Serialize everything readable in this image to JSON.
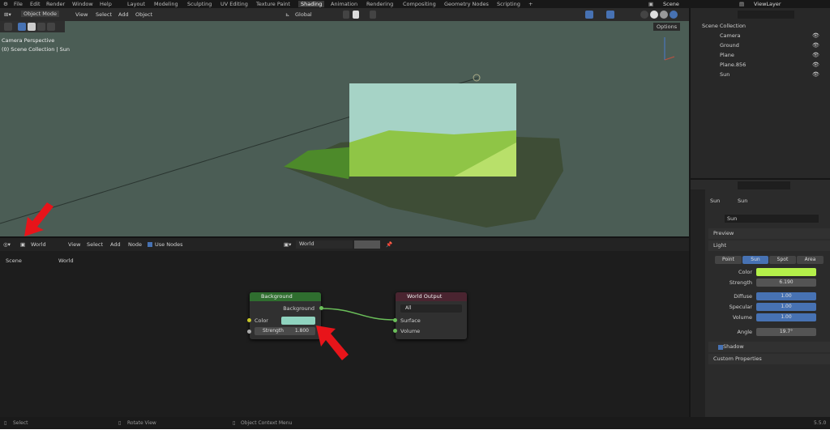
{
  "menu": [
    "File",
    "Edit",
    "Render",
    "Window",
    "Help"
  ],
  "workspaces": [
    "Layout",
    "Modeling",
    "Sculpting",
    "UV Editing",
    "Texture Paint",
    "Shading",
    "Animation",
    "Rendering",
    "Compositing",
    "Geometry Nodes",
    "Scripting",
    "+"
  ],
  "active_workspace": "Shading",
  "scene": "Scene",
  "view_layer": "ViewLayer",
  "viewport": {
    "mode": "Object Mode",
    "menus": [
      "View",
      "Select",
      "Add",
      "Object"
    ],
    "orientation": "Global",
    "options": "Options",
    "overlay_title": "Camera Perspective",
    "overlay_sub": "(0) Scene Collection | Sun",
    "bg": "#4b5d55"
  },
  "outliner": {
    "root": "Scene Collection",
    "items": [
      "Camera",
      "Ground",
      "Plane",
      "Plane.856",
      "Sun"
    ]
  },
  "properties": {
    "breadcrumb_obj": "Sun",
    "breadcrumb_data": "Sun",
    "datablock": "Sun",
    "preview": "Preview",
    "light": "Light",
    "types": [
      "Point",
      "Sun",
      "Spot",
      "Area"
    ],
    "active_type": "Sun",
    "color_label": "Color",
    "color": "#b4f04a",
    "strength_label": "Strength",
    "strength": "6.190",
    "diffuse_label": "Diffuse",
    "diffuse": "1.00",
    "specular_label": "Specular",
    "specular": "1.00",
    "volume_label": "Volume",
    "volume": "1.00",
    "angle_label": "Angle",
    "angle": "19.7°",
    "shadow": "Shadow",
    "custom": "Custom Properties"
  },
  "node_editor": {
    "type": "World",
    "menus": [
      "View",
      "Select",
      "Add",
      "Node"
    ],
    "use_nodes": "Use Nodes",
    "world": "World",
    "crumb_scene": "Scene",
    "crumb_world": "World",
    "bg_node": {
      "title": "Background",
      "out": "Background",
      "color_label": "Color",
      "color": "#8fd3bf",
      "strength_label": "Strength",
      "strength": "1.800"
    },
    "out_node": {
      "title": "World Output",
      "target": "All",
      "surface": "Surface",
      "volume": "Volume"
    }
  },
  "status": {
    "select": "Select",
    "rotate": "Rotate View",
    "context": "Object Context Menu",
    "version": "5.5.0"
  }
}
